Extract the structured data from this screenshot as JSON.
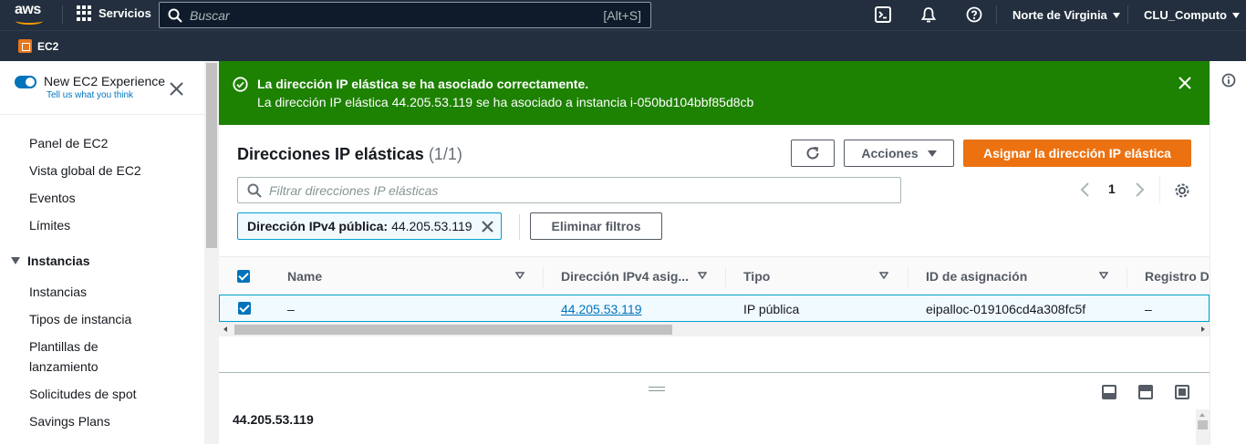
{
  "topnav": {
    "logo_text": "aws",
    "services_label": "Servicios",
    "search_placeholder": "Buscar",
    "search_shortcut": "[Alt+S]",
    "region_label": "Norte de Virginia",
    "account_label": "CLU_Computo"
  },
  "subnav": {
    "service_label": "EC2"
  },
  "sidebar": {
    "experience_title": "New EC2 Experience",
    "experience_link": "Tell us what you think",
    "links": [
      "Panel de EC2",
      "Vista global de EC2",
      "Eventos",
      "Límites"
    ],
    "section_title": "Instancias",
    "section_links": [
      "Instancias",
      "Tipos de instancia",
      "Plantillas de",
      "lanzamiento",
      "Solicitudes de spot",
      "Savings Plans"
    ]
  },
  "flash": {
    "header": "La dirección IP elástica se ha asociado correctamente.",
    "body": "La dirección IP elástica 44.205.53.119 se ha asociado a instancia i-050bd104bbf85d8cb"
  },
  "panel": {
    "title": "Direcciones IP elásticas",
    "count": "(1/1)",
    "actions_label": "Acciones",
    "allocate_label": "Asignar la dirección IP elástica",
    "filter_placeholder": "Filtrar direcciones IP elásticas",
    "page_number": "1",
    "token_key": "Dirección IPv4 pública:",
    "token_value": "44.205.53.119",
    "clear_filters_label": "Eliminar filtros"
  },
  "table": {
    "columns": [
      "Name",
      "Dirección IPv4 asig...",
      "Tipo",
      "ID de asignación",
      "Registro DNS inverso"
    ],
    "rows": [
      {
        "name": "–",
        "ip": "44.205.53.119",
        "type": "IP pública",
        "allocation_id": "eipalloc-019106cd4a308fc5f",
        "reverse_dns": "–"
      }
    ]
  },
  "detail": {
    "title": "44.205.53.119"
  },
  "colors": {
    "nav_bg": "#232f3e",
    "success": "#1d8102",
    "primary": "#ec7211",
    "link": "#0073bb"
  }
}
